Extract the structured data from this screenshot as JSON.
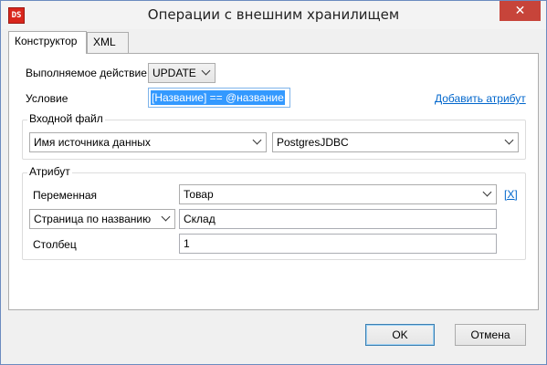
{
  "window": {
    "title": "Операции с внешним хранилищем",
    "icon_text": "DS",
    "close_symbol": "✕"
  },
  "tabs": [
    {
      "label": "Конструктор",
      "active": true
    },
    {
      "label": "XML",
      "active": false
    }
  ],
  "form": {
    "action_label": "Выполняемое действие",
    "action_value": "UPDATE",
    "condition_label": "Условие",
    "condition_value": "[Название] == @название",
    "add_attribute_link": "Добавить атрибут"
  },
  "input_file": {
    "group_title": "Входной файл",
    "source_type": "Имя источника данных",
    "source_value": "PostgresJDBC"
  },
  "attribute": {
    "group_title": "Атрибут",
    "variable_label": "Переменная",
    "variable_value": "Товар",
    "remove_link": "[X]",
    "page_selector": "Страница по названию",
    "page_value": "Склад",
    "column_label": "Столбец",
    "column_value": "1"
  },
  "buttons": {
    "ok": "OK",
    "cancel": "Отмена"
  }
}
